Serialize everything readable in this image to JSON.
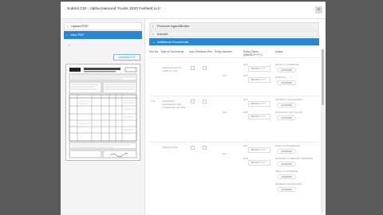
{
  "modal": {
    "title": "Submit CDI - Alpha Diamond Trucks 2020 Fairfield LLC",
    "close_glyph": "×"
  },
  "left": {
    "nav": [
      {
        "label": "Upload PDF",
        "chevron": "›"
      },
      {
        "label": "View PDF",
        "chevron": "›"
      }
    ],
    "page_marker": "»",
    "download_label": "Download PDF"
  },
  "sections": [
    {
      "label": "Producer Agent/Broker",
      "chevron": "›"
    },
    {
      "label": "Insured",
      "chevron": "›"
    },
    {
      "label": "Additional Documents",
      "chevron": "⌄"
    }
  ],
  "table": {
    "headers": [
      "Doc No",
      "Type of Documents",
      "Auto Sent",
      "Auto Rec",
      "Policy Number",
      "Policy Dates (MM/DD/YYYY)",
      "Action"
    ],
    "rows": [
      {
        "type": "CERTIFICATE OF LIABILITY INS",
        "no": "",
        "policy": "N/A",
        "dates": [
          {
            "prefix": "EFF",
            "value": "MM/DD/YYYY"
          },
          {
            "prefix": "EXP",
            "value": "MM/DD/YYYY"
          }
        ],
        "actions": [
          "SELECT COVERAGE",
          "CONFIRM",
          "DISPUTE",
          "CONFIRM"
        ]
      },
      {
        "type": "WORKERS COMPENSATION COVERAGE LETTER",
        "no": "1/11",
        "policy": "N/A",
        "dates": [
          {
            "prefix": "EFF",
            "value": "MM/DD/YYYY"
          },
          {
            "prefix": "EXP",
            "value": "MM/DD/YYYY"
          }
        ],
        "actions": [
          "GENERAL AGGREGATE",
          "CONFIRM",
          "PERSONAL ADV INJURY",
          "CONFIRM"
        ]
      },
      {
        "type": "CERTIFICATE",
        "no": "",
        "policy": "N/A",
        "dates": [
          {
            "prefix": "EFF",
            "value": "MM/DD/YYYY"
          },
          {
            "prefix": "EXP",
            "value": "MM/DD/YYYY"
          }
        ],
        "actions": [
          "EACH OCCURRENCE",
          "CONFIRM",
          "DAMAGE TO RENTED PREMISES",
          "CONFIRM",
          "MEDICAL EXPENSE",
          "CONFIRM",
          "GENERAL AGGREGATE",
          "CONFIRM"
        ]
      }
    ]
  }
}
